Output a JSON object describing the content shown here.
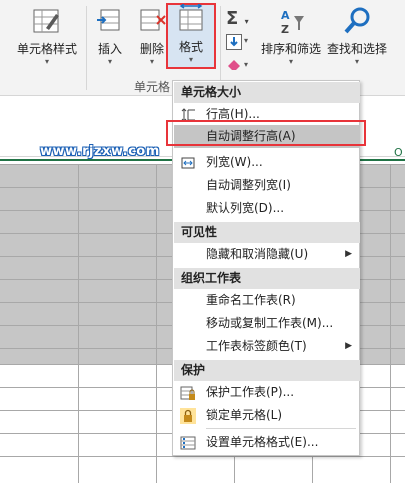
{
  "ribbon": {
    "cell_styles_label": "单元格样式",
    "insert_label": "插入",
    "delete_label": "删除",
    "format_label": "格式",
    "sort_filter_label": "排序和筛选",
    "find_select_label": "查找和选择",
    "cells_group_label": "单元格",
    "accent_color": "#e8343a"
  },
  "watermark": "www.rjzxw.com",
  "corner_mark": "O",
  "menu": {
    "sections": {
      "cell_size": "单元格大小",
      "visibility": "可见性",
      "organize": "组织工作表",
      "protect": "保护"
    },
    "items": {
      "row_height": "行高(H)...",
      "autofit_row_height": "自动调整行高(A)",
      "column_width": "列宽(W)...",
      "autofit_column_width": "自动调整列宽(I)",
      "default_width": "默认列宽(D)...",
      "hide_unhide": "隐藏和取消隐藏(U)",
      "rename_sheet": "重命名工作表(R)",
      "move_copy_sheet": "移动或复制工作表(M)...",
      "tab_color": "工作表标签颜色(T)",
      "protect_sheet": "保护工作表(P)...",
      "lock_cell": "锁定单元格(L)",
      "format_cells": "设置单元格格式(E)..."
    }
  }
}
